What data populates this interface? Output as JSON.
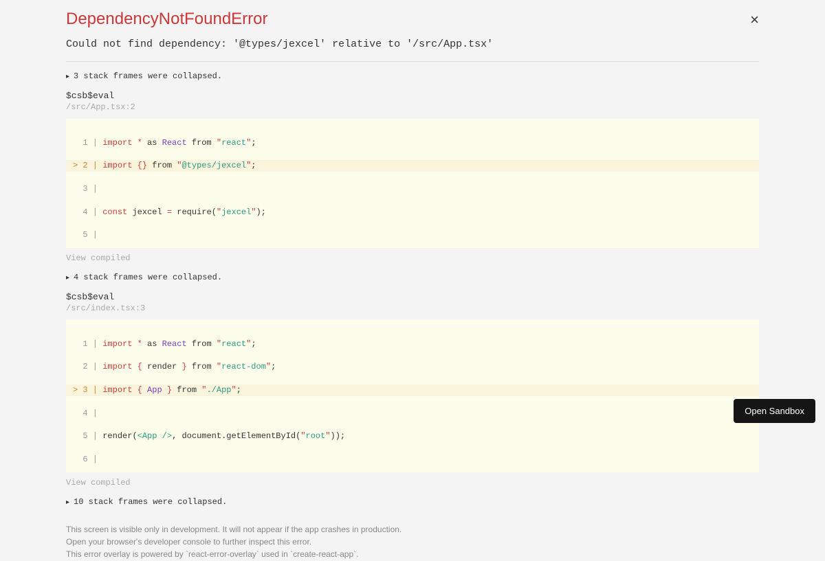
{
  "error": {
    "title": "DependencyNotFoundError",
    "message": "Could not find dependency: '@types/jexcel' relative to '/src/App.tsx'"
  },
  "collapse1": "3 stack frames were collapsed.",
  "frame1": {
    "fn": "$csb$eval",
    "loc": "/src/App.tsx:2",
    "view": "View compiled"
  },
  "collapse2": "4 stack frames were collapsed.",
  "frame2": {
    "fn": "$csb$eval",
    "loc": "/src/index.tsx:3",
    "view": "View compiled"
  },
  "collapse3": "10 stack frames were collapsed.",
  "footer": {
    "line1": "This screen is visible only in development. It will not appear if the app crashes in production.",
    "line2": "Open your browser's developer console to further inspect this error.",
    "line3": "This error overlay is powered by `react-error-overlay` used in `create-react-app`."
  },
  "sandbox_button": "Open Sandbox"
}
